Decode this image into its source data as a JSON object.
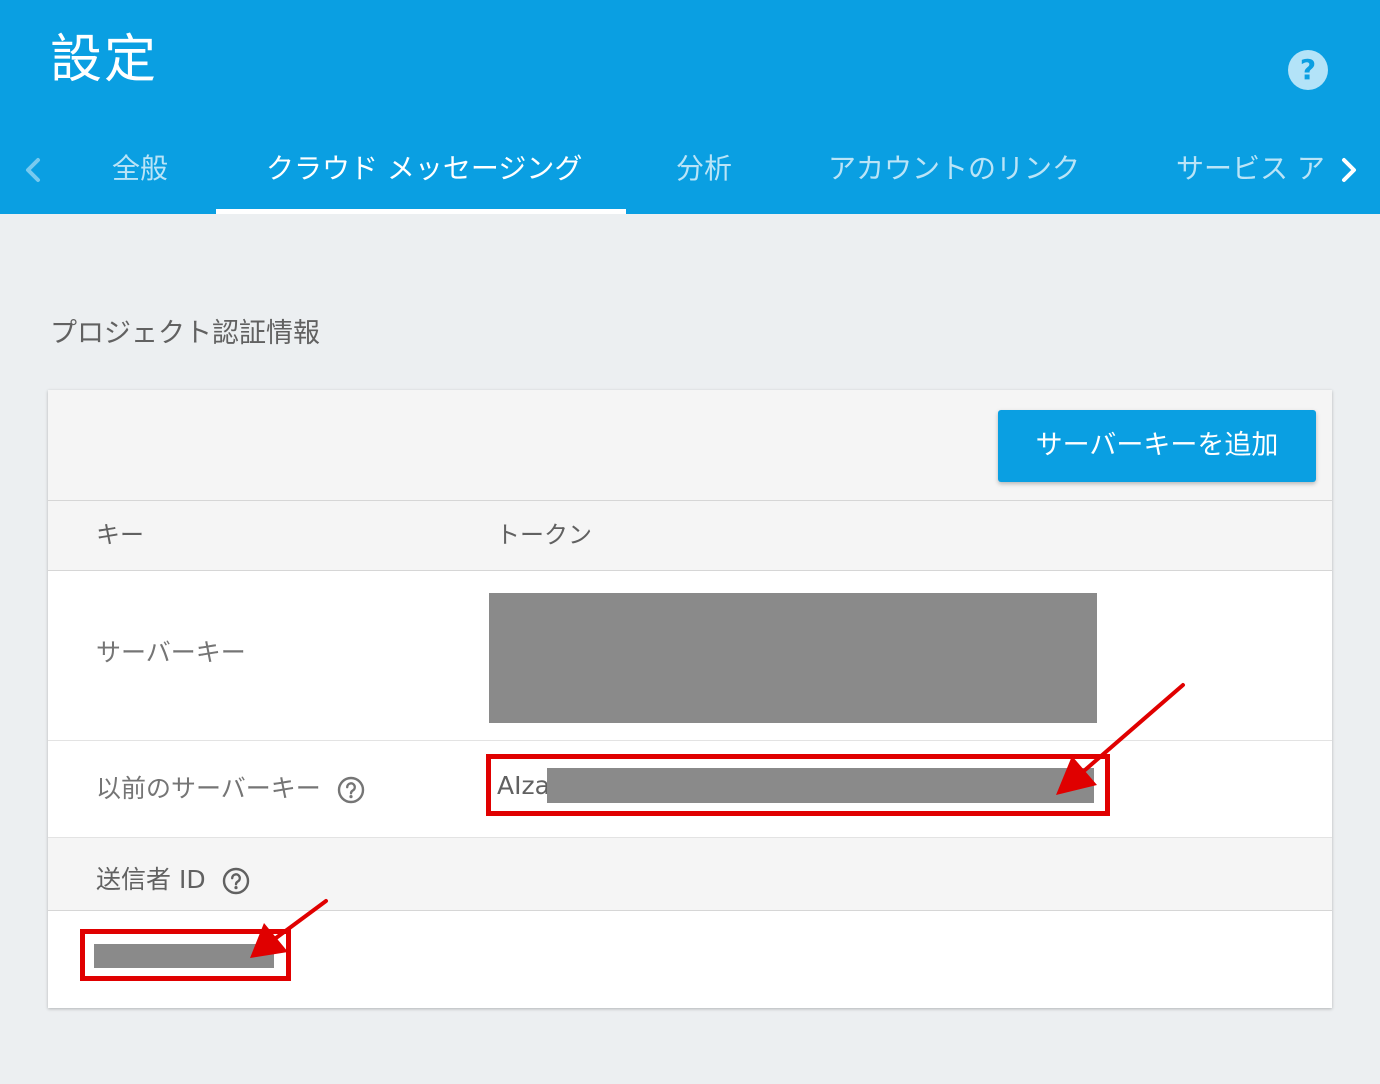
{
  "header": {
    "title": "設定",
    "help_icon": "help-circle-icon",
    "help_glyph": "?"
  },
  "tabs": [
    {
      "label": "全般",
      "active": false
    },
    {
      "label": "クラウド メッセージング",
      "active": true
    },
    {
      "label": "分析",
      "active": false
    },
    {
      "label": "アカウントのリンク",
      "active": false
    },
    {
      "label": "サービス ア",
      "active": false
    }
  ],
  "section": {
    "heading": "プロジェクト認証情報"
  },
  "card": {
    "add_key_label": "サーバーキーを追加",
    "columns": {
      "key": "キー",
      "token": "トークン"
    },
    "rows": {
      "server_key": {
        "label": "サーバーキー"
      },
      "legacy_server_key": {
        "label": "以前のサーバーキー",
        "token_prefix": "AIza"
      },
      "sender_id": {
        "label": "送信者 ID"
      }
    }
  },
  "colors": {
    "brand": "#0a9fe2",
    "annotation": "#e00000",
    "redaction": "#8a8a8a"
  }
}
